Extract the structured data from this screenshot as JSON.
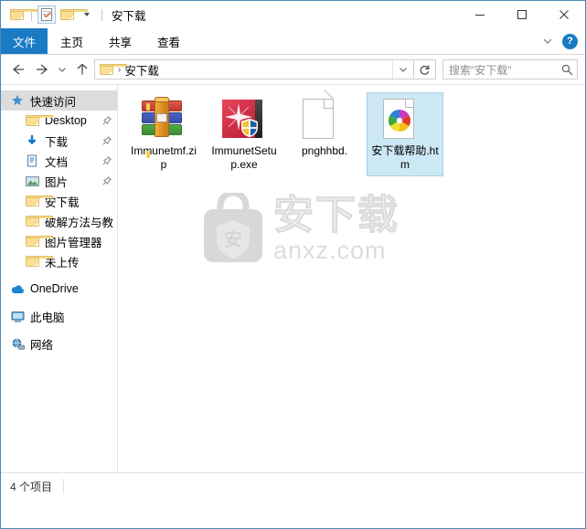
{
  "window": {
    "title": "安下载",
    "quick_access": [
      {
        "name": "folder-icon",
        "label": "文件夹"
      },
      {
        "name": "properties-icon",
        "label": "属性"
      },
      {
        "name": "new-folder-icon",
        "label": "新建文件夹"
      },
      {
        "name": "chevron-down-icon",
        "label": "自定义快速访问工具栏"
      }
    ],
    "controls": {
      "minimize": "最小化",
      "maximize": "最大化",
      "close": "关闭"
    }
  },
  "ribbon": {
    "tabs": [
      {
        "label": "文件",
        "active": true
      },
      {
        "label": "主页",
        "active": false
      },
      {
        "label": "共享",
        "active": false
      },
      {
        "label": "查看",
        "active": false
      }
    ],
    "minimize_label": "折叠功能区",
    "help_label": "?"
  },
  "address": {
    "back": "后退",
    "forward": "前进",
    "recent": "最近浏览的位置",
    "up": "向上",
    "breadcrumb_separator": "›",
    "path": "安下载",
    "dropdown": "展开",
    "refresh": "刷新"
  },
  "search": {
    "placeholder": "搜索\"安下载\"",
    "value": "",
    "icon": "search-icon"
  },
  "navpane": {
    "items": [
      {
        "label": "快速访问",
        "icon": "star-icon",
        "selected": true,
        "indent": false,
        "pinned": false,
        "group": false
      },
      {
        "label": "Desktop",
        "icon": "folder-icon",
        "selected": false,
        "indent": true,
        "pinned": true,
        "group": false
      },
      {
        "label": "下载",
        "icon": "download-icon",
        "selected": false,
        "indent": true,
        "pinned": true,
        "group": false
      },
      {
        "label": "文档",
        "icon": "documents-icon",
        "selected": false,
        "indent": true,
        "pinned": true,
        "group": false
      },
      {
        "label": "图片",
        "icon": "pictures-icon",
        "selected": false,
        "indent": true,
        "pinned": true,
        "group": false
      },
      {
        "label": "安下载",
        "icon": "folder-icon",
        "selected": false,
        "indent": true,
        "pinned": false,
        "group": false
      },
      {
        "label": "破解方法与教",
        "icon": "folder-icon",
        "selected": false,
        "indent": true,
        "pinned": false,
        "group": false
      },
      {
        "label": "图片管理器",
        "icon": "folder-icon",
        "selected": false,
        "indent": true,
        "pinned": false,
        "group": false
      },
      {
        "label": "未上传",
        "icon": "folder-icon",
        "selected": false,
        "indent": true,
        "pinned": false,
        "group": false
      },
      {
        "label": "OneDrive",
        "icon": "onedrive-icon",
        "selected": false,
        "indent": false,
        "pinned": false,
        "group": true
      },
      {
        "label": "此电脑",
        "icon": "this-pc-icon",
        "selected": false,
        "indent": false,
        "pinned": false,
        "group": true
      },
      {
        "label": "网络",
        "icon": "network-icon",
        "selected": false,
        "indent": false,
        "pinned": false,
        "group": true
      }
    ]
  },
  "files": [
    {
      "name": "Immunetmf.zip",
      "icon": "zip-archive-icon",
      "selected": false
    },
    {
      "name": "ImmunetSetup.exe",
      "icon": "executable-icon",
      "selected": false
    },
    {
      "name": "pnghhbd.",
      "icon": "blank-document-icon",
      "selected": false
    },
    {
      "name": "安下载帮助.htm",
      "icon": "html-document-icon",
      "selected": true
    }
  ],
  "watermark": {
    "logo_char": "安",
    "brand": "安下载",
    "site": "anxz.com"
  },
  "statusbar": {
    "item_count": "4 个项目"
  },
  "colors": {
    "accent": "#1a7bc4",
    "selection_fill": "#cce8f4",
    "selection_border": "#a4d3ea",
    "nav_selected": "#dcdcdc",
    "window_border": "#4a8ab0",
    "watermark": "#dcdcdc"
  }
}
